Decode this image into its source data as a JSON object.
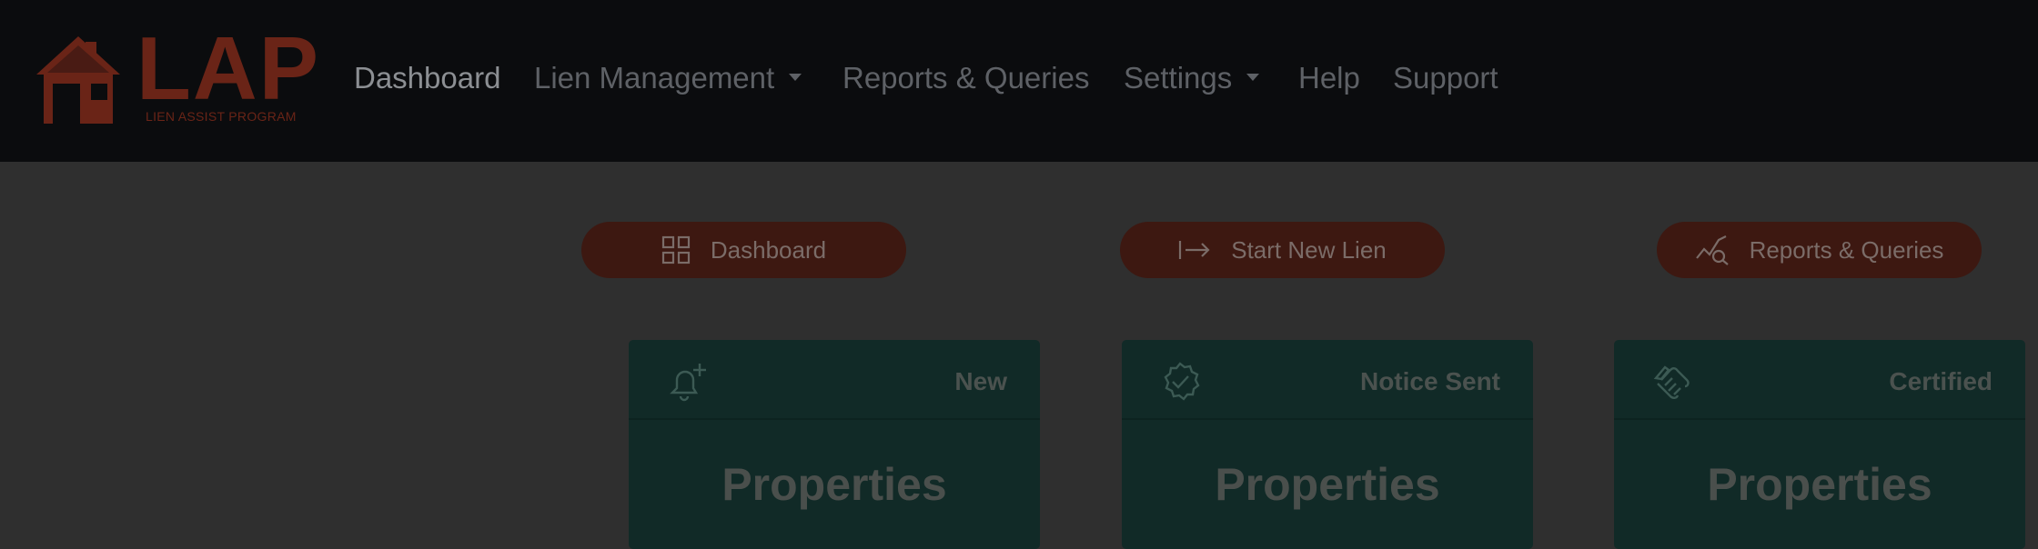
{
  "brand": {
    "name": "LAP",
    "tagline": "LIEN ASSIST PROGRAM",
    "color": "#6a2417"
  },
  "nav": {
    "items": [
      {
        "label": "Dashboard",
        "active": true
      },
      {
        "label": "Lien Management",
        "dropdown": true
      },
      {
        "label": "Reports & Queries"
      },
      {
        "label": "Settings",
        "dropdown": true
      },
      {
        "label": "Help"
      },
      {
        "label": "Support"
      }
    ]
  },
  "actions": [
    {
      "label": "Dashboard",
      "icon": "grid-icon"
    },
    {
      "label": "Start New Lien",
      "icon": "arrow-right-bar-icon"
    },
    {
      "label": "Reports & Queries",
      "icon": "chart-search-icon"
    }
  ],
  "cards": [
    {
      "status": "New",
      "title": "Properties",
      "icon": "bell-plus-icon"
    },
    {
      "status": "Notice Sent",
      "title": "Properties",
      "icon": "badge-check-icon"
    },
    {
      "status": "Certified",
      "title": "Properties",
      "icon": "handshake-icon"
    }
  ],
  "colors": {
    "navbar": "#0b0c0e",
    "background": "#2f2f2f",
    "pill": "#3d1811",
    "card": "#112a27"
  }
}
